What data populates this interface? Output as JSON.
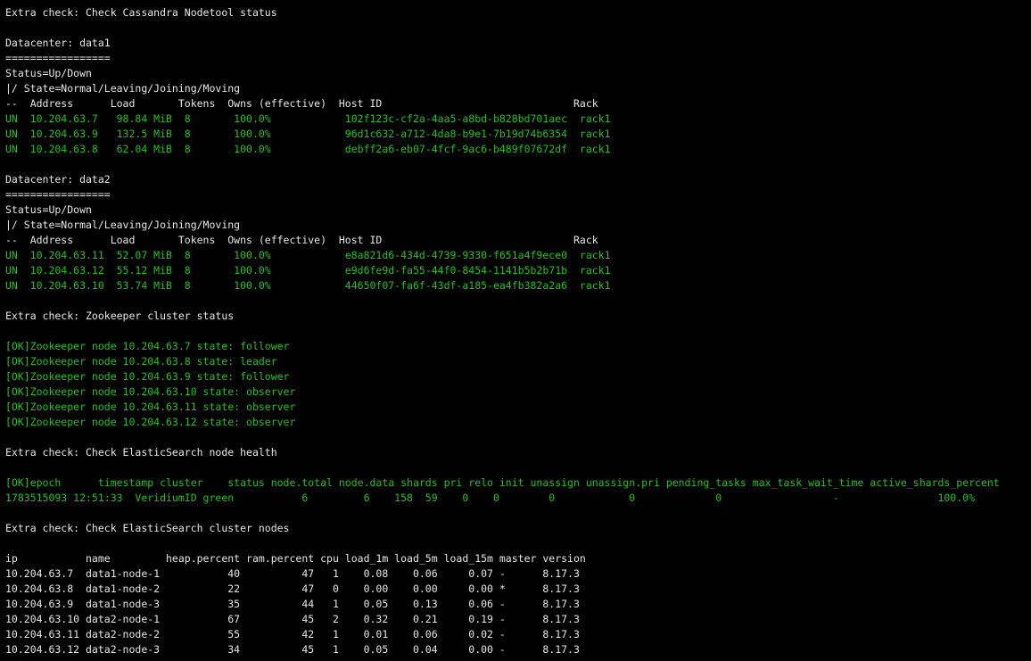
{
  "terminal": {
    "lines": [
      {
        "text": "Extra check: Check Cassandra Nodetool status",
        "color": "white"
      },
      {
        "text": "",
        "color": "white"
      },
      {
        "text": "Datacenter: data1",
        "color": "white"
      },
      {
        "text": "=================",
        "color": "white"
      },
      {
        "text": "Status=Up/Down",
        "color": "white"
      },
      {
        "text": "|/ State=Normal/Leaving/Joining/Moving",
        "color": "white"
      },
      {
        "text": "--  Address      Load       Tokens  Owns (effective)  Host ID                               Rack",
        "color": "white"
      },
      {
        "text": "UN  10.204.63.7   98.84 MiB  8       100.0%            102f123c-cf2a-4aa5-a8bd-b828bd701aec  rack1",
        "color": "green"
      },
      {
        "text": "UN  10.204.63.9   132.5 MiB  8       100.0%            96d1c632-a712-4da8-b9e1-7b19d74b6354  rack1",
        "color": "green"
      },
      {
        "text": "UN  10.204.63.8   62.04 MiB  8       100.0%            debff2a6-eb07-4fcf-9ac6-b489f07672df  rack1",
        "color": "green"
      },
      {
        "text": "",
        "color": "white"
      },
      {
        "text": "Datacenter: data2",
        "color": "white"
      },
      {
        "text": "=================",
        "color": "white"
      },
      {
        "text": "Status=Up/Down",
        "color": "white"
      },
      {
        "text": "|/ State=Normal/Leaving/Joining/Moving",
        "color": "white"
      },
      {
        "text": "--  Address      Load       Tokens  Owns (effective)  Host ID                               Rack",
        "color": "white"
      },
      {
        "text": "UN  10.204.63.11  52.07 MiB  8       100.0%            e8a821d6-434d-4739-9330-f651a4f9ece0  rack1",
        "color": "green"
      },
      {
        "text": "UN  10.204.63.12  55.12 MiB  8       100.0%            e9d6fe9d-fa55-44f0-8454-1141b5b2b71b  rack1",
        "color": "green"
      },
      {
        "text": "UN  10.204.63.10  53.74 MiB  8       100.0%            44650f07-fa6f-43df-a185-ea4fb382a2a6  rack1",
        "color": "green"
      },
      {
        "text": "",
        "color": "white"
      },
      {
        "text": "Extra check: Zookeeper cluster status",
        "color": "white"
      },
      {
        "text": "",
        "color": "white"
      },
      {
        "text": "[OK]Zookeeper node 10.204.63.7 state: follower",
        "color": "green"
      },
      {
        "text": "[OK]Zookeeper node 10.204.63.8 state: leader",
        "color": "green"
      },
      {
        "text": "[OK]Zookeeper node 10.204.63.9 state: follower",
        "color": "green"
      },
      {
        "text": "[OK]Zookeeper node 10.204.63.10 state: observer",
        "color": "green"
      },
      {
        "text": "[OK]Zookeeper node 10.204.63.11 state: observer",
        "color": "green"
      },
      {
        "text": "[OK]Zookeeper node 10.204.63.12 state: observer",
        "color": "green"
      },
      {
        "text": "",
        "color": "white"
      },
      {
        "text": "Extra check: Check ElasticSearch node health",
        "color": "white"
      },
      {
        "text": "",
        "color": "white"
      },
      {
        "text": "[OK]epoch      timestamp cluster    status node.total node.data shards pri relo init unassign unassign.pri pending_tasks max_task_wait_time active_shards_percent",
        "color": "green"
      },
      {
        "text": "1783515093 12:51:33  VeridiumID green           6         6    158  59    0    0        0            0             0                  -                100.0%",
        "color": "green"
      },
      {
        "text": "",
        "color": "white"
      },
      {
        "text": "Extra check: Check ElasticSearch cluster nodes",
        "color": "white"
      },
      {
        "text": "",
        "color": "white"
      },
      {
        "text": "ip           name         heap.percent ram.percent cpu load_1m load_5m load_15m master version",
        "color": "white"
      },
      {
        "text": "10.204.63.7  data1-node-1           40          47   1    0.08    0.06     0.07 -      8.17.3",
        "color": "white"
      },
      {
        "text": "10.204.63.8  data1-node-2           22          47   0    0.00    0.00     0.00 *      8.17.3",
        "color": "white"
      },
      {
        "text": "10.204.63.9  data1-node-3           35          44   1    0.05    0.13     0.06 -      8.17.3",
        "color": "white"
      },
      {
        "text": "10.204.63.10 data2-node-1           67          45   2    0.32    0.21     0.19 -      8.17.3",
        "color": "white"
      },
      {
        "text": "10.204.63.11 data2-node-2           55          42   1    0.01    0.06     0.02 -      8.17.3",
        "color": "white"
      },
      {
        "text": "10.204.63.12 data2-node-3           34          45   1    0.05    0.04     0.00 -      8.17.3",
        "color": "white"
      }
    ],
    "colors": {
      "background": "#000000",
      "white": "#e6e6e6",
      "green": "#23c21d"
    }
  }
}
